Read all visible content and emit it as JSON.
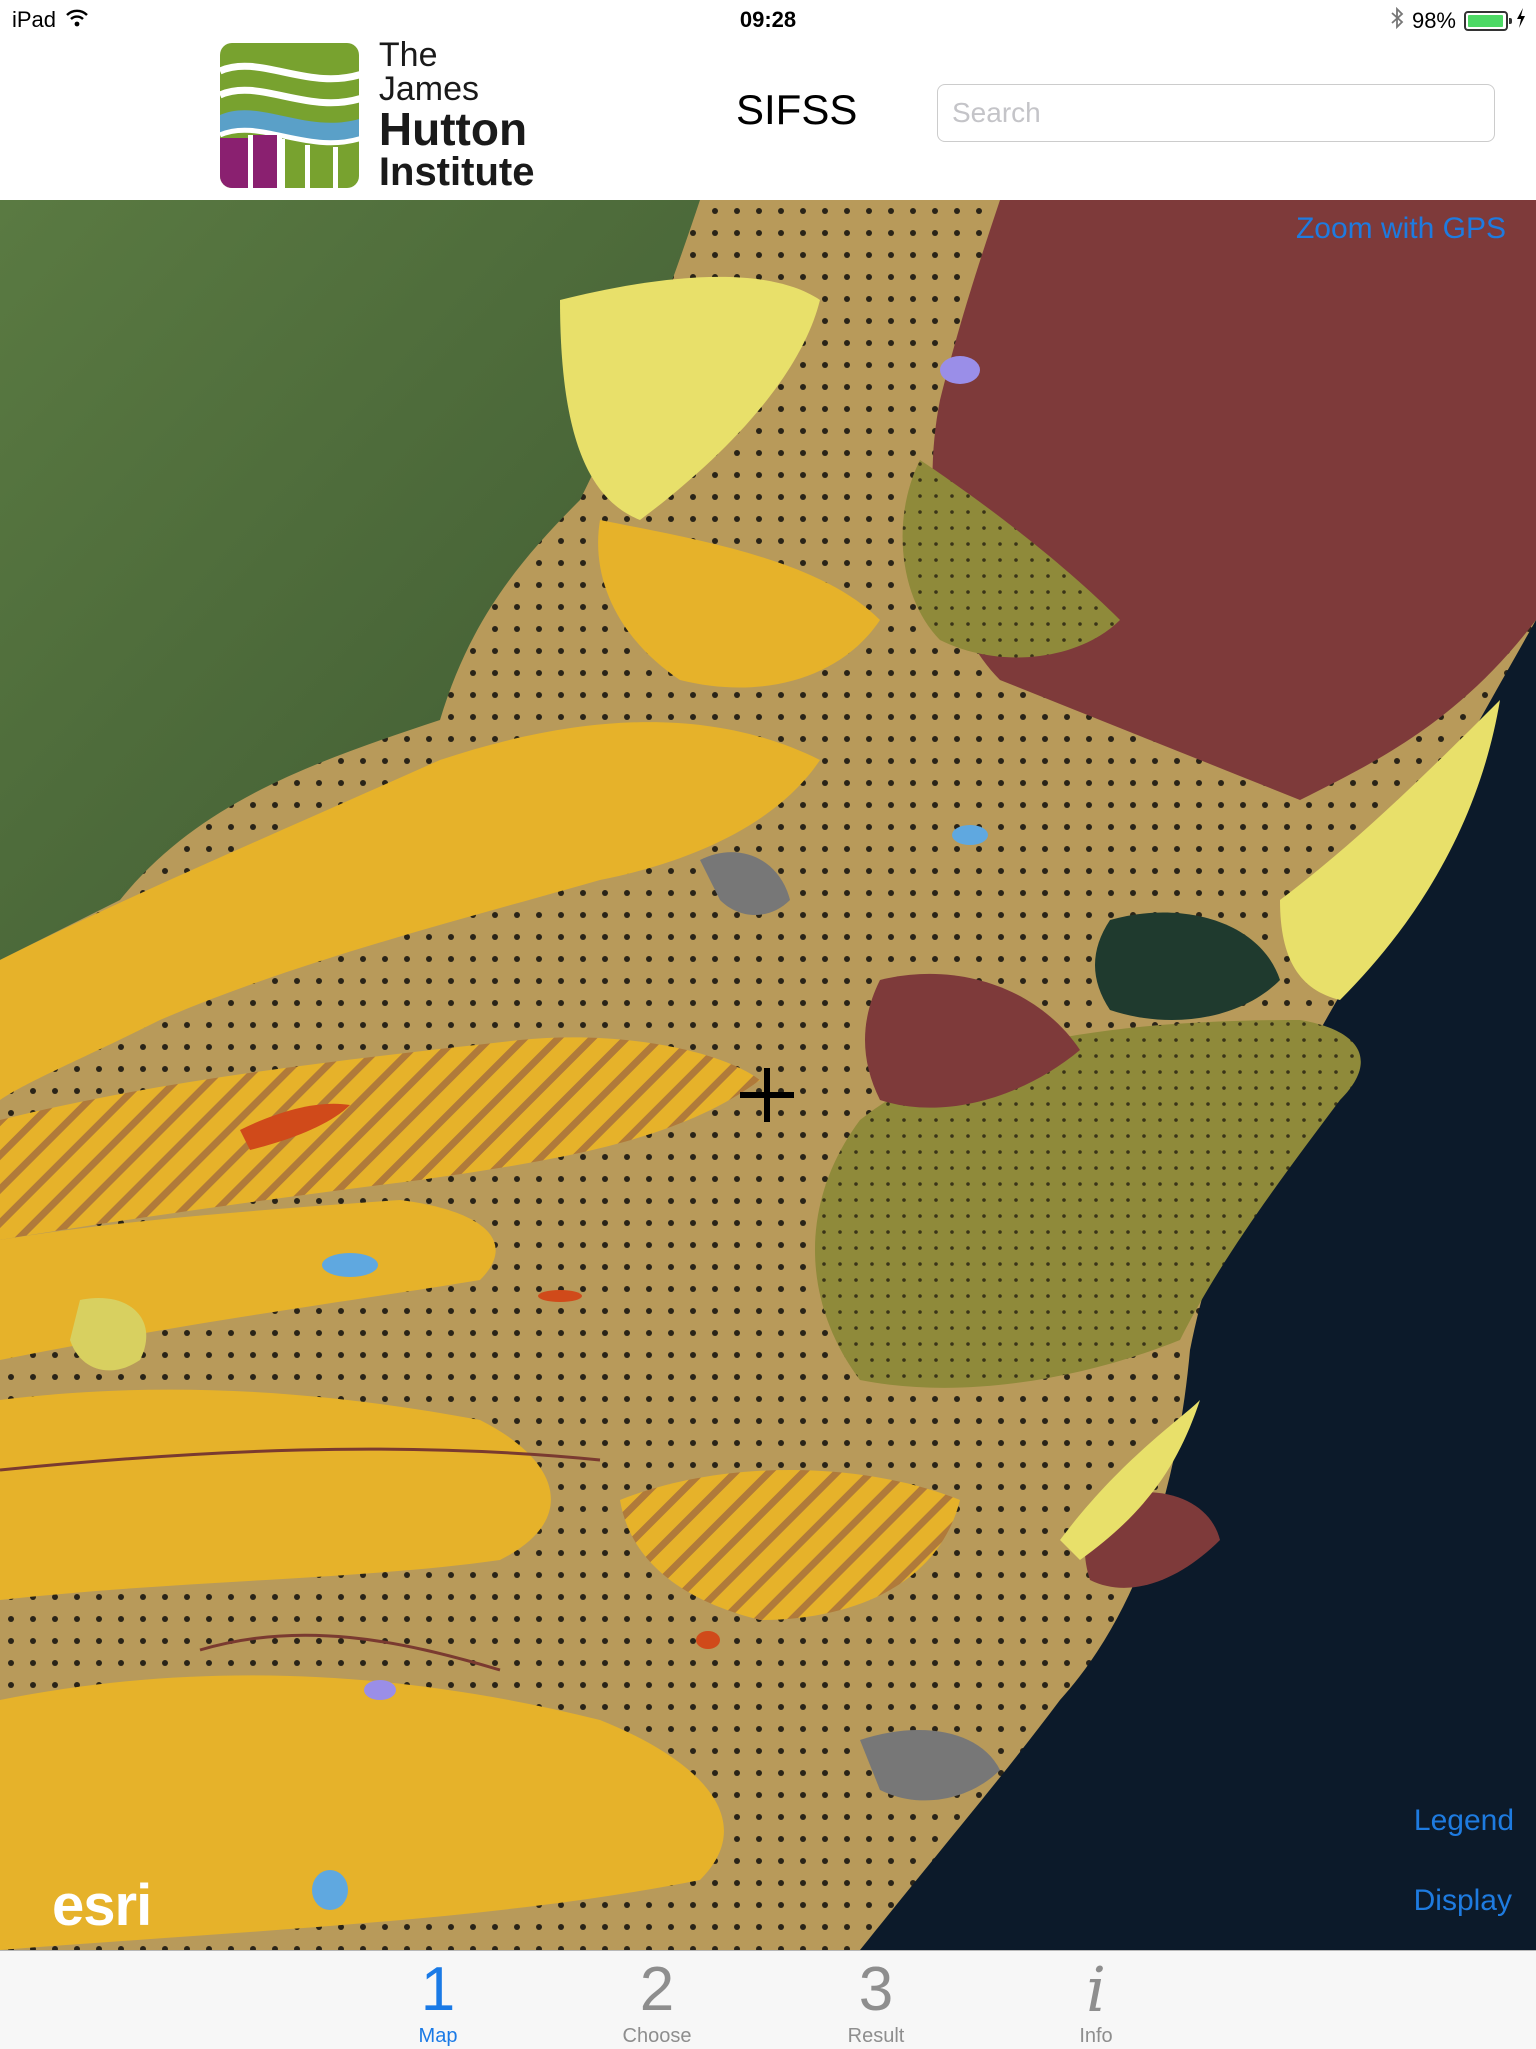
{
  "status_bar": {
    "device": "iPad",
    "time": "09:28",
    "battery": "98%",
    "battery_level": 0.98,
    "icons": [
      "wifi-icon",
      "bluetooth-icon",
      "battery-icon",
      "charging-bolt-icon"
    ]
  },
  "header": {
    "logo": {
      "line1": "The James",
      "line2": "Hutton",
      "line3": "Institute"
    },
    "app_title": "SIFSS",
    "search_placeholder": "Search",
    "search_value": ""
  },
  "map": {
    "zoom_gps_label": "Zoom with GPS",
    "legend_label": "Legend",
    "display_label": "Display",
    "attribution": "esri",
    "colors": {
      "ochre": "#e6b22a",
      "pale_yellow": "#e8e06a",
      "maroon": "#7e3a3a",
      "olive": "#8f8a3a",
      "tan_dotted": "#b89a5a",
      "sea": "#0c1a2a",
      "forest": "#4d6a3a",
      "lake": "#5fa8e0",
      "lavender": "#9a8ee8",
      "red_orange": "#d04a1a"
    }
  },
  "tabs": [
    {
      "number": "1",
      "label": "Map",
      "active": true
    },
    {
      "number": "2",
      "label": "Choose",
      "active": false
    },
    {
      "number": "3",
      "label": "Result",
      "active": false
    },
    {
      "number": "i",
      "label": "Info",
      "active": false
    }
  ]
}
